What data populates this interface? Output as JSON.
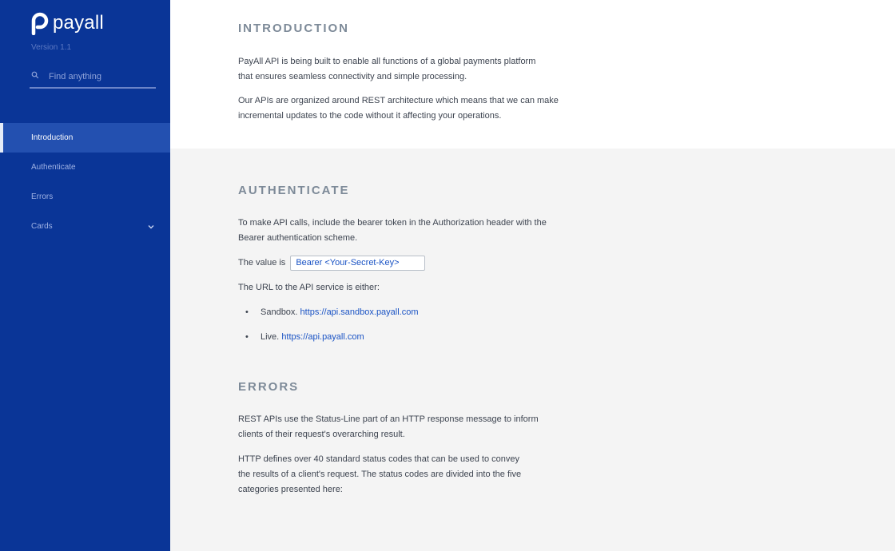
{
  "sidebar": {
    "logo_text": "payall",
    "version": "Version 1.1",
    "search": {
      "placeholder": "Find anything"
    },
    "items": [
      {
        "label": "Introduction",
        "active": true
      },
      {
        "label": "Authenticate",
        "active": false
      },
      {
        "label": "Errors",
        "active": false
      },
      {
        "label": "Cards",
        "active": false,
        "expandable": true
      }
    ]
  },
  "introduction": {
    "title": "INTRODUCTION",
    "p1_line1": "PayAll API is being built to enable all functions of a global payments platform",
    "p1_line2": "that ensures seamless connectivity and simple processing.",
    "p2_line1": "Our APIs are organized around REST architecture which means that we can make",
    "p2_line2": "incremental updates to the code without it affecting your operations."
  },
  "authenticate": {
    "title": "AUTHENTICATE",
    "p1_line1": "To make API calls, include the bearer token in the Authorization header with the",
    "p1_line2": "Bearer authentication scheme.",
    "value_label": "The value is",
    "value_code": "Bearer <Your-Secret-Key>",
    "url_intro": "The URL to the API service is either:",
    "urls": [
      {
        "bullet": "•",
        "label": "Sandbox.",
        "link": "https://api.sandbox.payall.com"
      },
      {
        "bullet": "•",
        "label": "Live.",
        "link": "https://api.payall.com"
      }
    ]
  },
  "errors": {
    "title": "ERRORS",
    "p1_line1": "REST APIs use the Status-Line part of an HTTP response message to inform",
    "p1_line2": "clients of their request's overarching result.",
    "p2_line1": "HTTP defines over 40 standard status codes that can be used to convey",
    "p2_line2": "the results of a client's request. The status codes are divided into the five",
    "p2_line3": "categories presented here:"
  },
  "colors": {
    "sidebar_bg": "#0a3597",
    "sidebar_active_bg": "#2350b0",
    "link": "#1a53c4",
    "heading": "#7d8a98"
  },
  "icons": {
    "logo": "payall-logo-icon",
    "search": "search-icon",
    "expand": "chevron-down-icon"
  }
}
